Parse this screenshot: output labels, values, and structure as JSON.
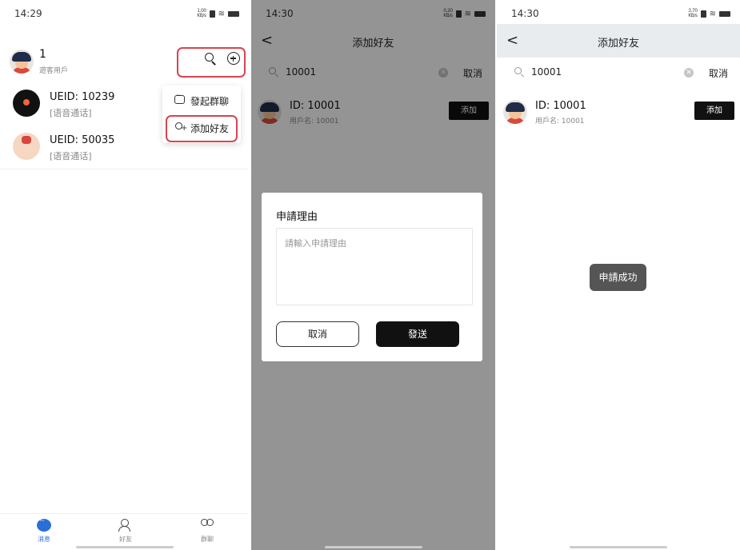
{
  "panel1": {
    "status": {
      "time": "14:29",
      "speed": "1.00\nKB/s"
    },
    "header": {
      "name": "1",
      "sub": "遊客用戶"
    },
    "conversations": [
      {
        "title": "UEID: 10239",
        "sub": "[语音通话]"
      },
      {
        "title": "UEID: 50035",
        "sub": "[语音通话]"
      }
    ],
    "menu": {
      "start_group": "發起群聊",
      "add_friend": "添加好友"
    },
    "tabs": [
      {
        "label": "消息"
      },
      {
        "label": "好友"
      },
      {
        "label": "群聊"
      }
    ]
  },
  "panel2": {
    "status": {
      "time": "14:30",
      "speed": "0.20\nKB/s"
    },
    "nav": {
      "back": "<",
      "title": "添加好友"
    },
    "search": {
      "value": "10001",
      "cancel": "取消"
    },
    "result": {
      "id": "ID: 10001",
      "username": "用戶名: 10001",
      "add": "添加"
    },
    "dialog": {
      "title": "申請理由",
      "placeholder": "請輸入申請理由",
      "cancel": "取消",
      "send": "發送"
    }
  },
  "panel3": {
    "status": {
      "time": "14:30",
      "speed": "3.70\nKB/s"
    },
    "nav": {
      "back": "<",
      "title": "添加好友"
    },
    "search": {
      "value": "10001",
      "cancel": "取消"
    },
    "result": {
      "id": "ID: 10001",
      "username": "用戶名: 10001",
      "add": "添加"
    },
    "toast": "申請成功"
  },
  "colors": {
    "highlight": "#d9444f",
    "accent": "#2a6fd6",
    "button_dark": "#111111"
  }
}
